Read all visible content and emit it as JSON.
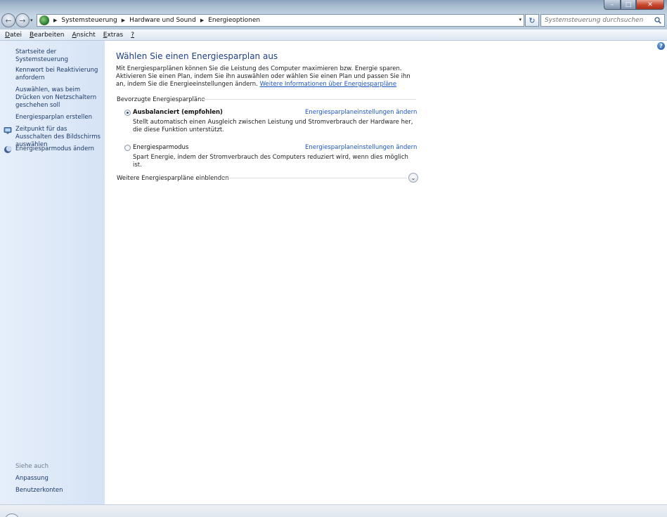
{
  "window": {
    "minimize": "–",
    "maximize": "□",
    "close": "✕"
  },
  "nav": {
    "back_icon": "←",
    "forward_icon": "→",
    "dropdown_icon": "▾"
  },
  "address": {
    "crumbs": [
      "Systemsteuerung",
      "Hardware und Sound",
      "Energieoptionen"
    ],
    "separator": "▶",
    "dropdown": "▾",
    "refresh": "↻"
  },
  "search": {
    "placeholder": "Systemsteuerung durchsuchen"
  },
  "menu": {
    "items": [
      {
        "u": "D",
        "rest": "atei"
      },
      {
        "u": "B",
        "rest": "earbeiten"
      },
      {
        "u": "A",
        "rest": "nsicht"
      },
      {
        "u": "E",
        "rest": "xtras"
      },
      {
        "u": "?",
        "rest": ""
      }
    ]
  },
  "sidebar": {
    "home": "Startseite der Systemsteuerung",
    "links": [
      "Kennwort bei Reaktivierung anfordern",
      "Auswählen, was beim Drücken von Netzschaltern geschehen soll",
      "Energiesparplan erstellen",
      "Zeitpunkt für das Ausschalten des Bildschirms auswählen",
      "Energiesparmodus ändern"
    ],
    "see_also_heading": "Siehe auch",
    "see_also": [
      "Anpassung",
      "Benutzerkonten"
    ]
  },
  "main": {
    "help": "?",
    "title": "Wählen Sie einen Energiesparplan aus",
    "intro": "Mit Energiesparplänen können Sie die Leistung des Computer maximieren bzw. Energie sparen. Aktivieren Sie einen Plan, indem Sie ihn auswählen oder wählen Sie einen Plan und passen Sie ihn an, indem Sie die Energieeinstellungen ändern.",
    "intro_link": "Weitere Informationen über Energiesparpläne",
    "preferred_heading": "Bevorzugte Energiesparpläne",
    "plans": [
      {
        "name": "Ausbalanciert (empfohlen)",
        "selected": true,
        "link": "Energiesparplaneinstellungen ändern",
        "description": "Stellt automatisch einen Ausgleich zwischen Leistung und Stromverbrauch der Hardware her, die diese Funktion unterstützt."
      },
      {
        "name": "Energiesparmodus",
        "selected": false,
        "link": "Energiesparplaneinstellungen ändern",
        "description": "Spart Energie, indem der Stromverbrauch des Computers reduziert wird, wenn dies möglich ist."
      }
    ],
    "more_plans": "Weitere Energiesparpläne einblenden",
    "expand_icon": "⌄"
  },
  "colors": {
    "link": "#1c55c6",
    "title": "#1e3f88",
    "sidebar": "#dbe7f7"
  }
}
